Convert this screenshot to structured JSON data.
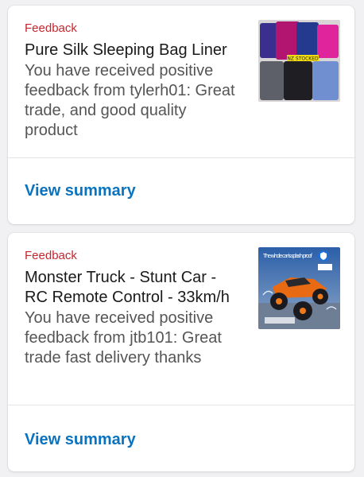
{
  "colors": {
    "category_red": "#c6262e",
    "link_blue": "#0a73c0",
    "title_text": "#1a1a1a",
    "body_text": "#555555"
  },
  "notifications": [
    {
      "category": "Feedback",
      "title": "Pure Silk Sleeping Bag Liner",
      "message": "You have received positive feedback from tylerh01: Great trade, and good quality product",
      "thumbnail_label": "NZ STOCKED",
      "link_label": "View summary"
    },
    {
      "category": "Feedback",
      "title": "Monster Truck - Stunt Car - RC Remote Control - 33km/h",
      "message": "You have received positive feedback from jtb101: Great trade fast delivery thanks",
      "thumbnail_label": "The whole car is splash proof",
      "link_label": "View summary"
    }
  ]
}
